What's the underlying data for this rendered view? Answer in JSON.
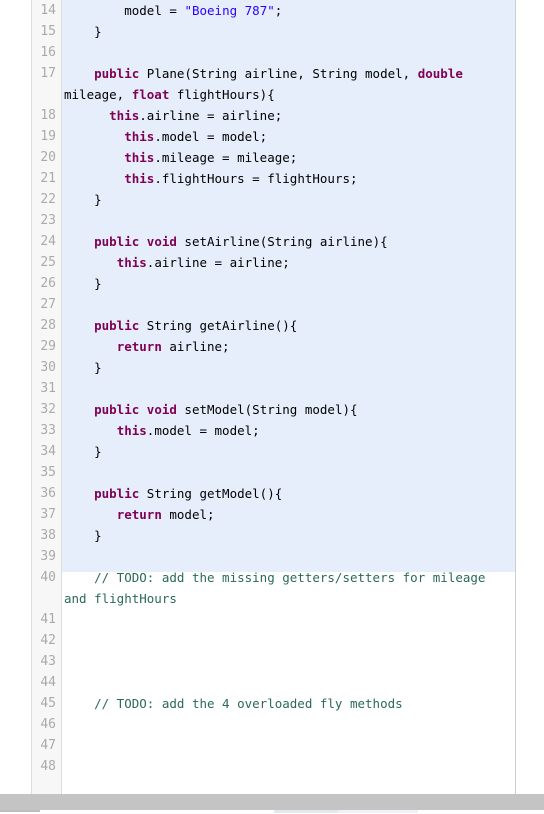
{
  "editor": {
    "language": "Java",
    "first_visible_line": 14,
    "last_visible_line": 48,
    "colors": {
      "background": "#ffffff",
      "selection_background": "#e6eefb",
      "gutter_background": "#f7f7f7",
      "gutter_border": "#dedede",
      "line_number": "#aaaaaa",
      "keyword": "#7f0055",
      "string": "#2a00ff",
      "comment": "#2a6b52",
      "plain_text": "#000000",
      "margin_guide": "#c9cdd4",
      "status_bar": "#c4c4c4"
    },
    "lines": [
      {
        "number": "14",
        "tokens": [
          {
            "t": "pln",
            "s": "        model = "
          },
          {
            "t": "str",
            "s": "\"Boeing 787\""
          },
          {
            "t": "pln",
            "s": ";"
          }
        ]
      },
      {
        "number": "15",
        "tokens": [
          {
            "t": "pln",
            "s": "    }"
          }
        ]
      },
      {
        "number": "16",
        "tokens": [
          {
            "t": "pln",
            "s": ""
          }
        ]
      },
      {
        "number": "17",
        "tokens": [
          {
            "t": "pln",
            "s": "    "
          },
          {
            "t": "kw",
            "s": "public"
          },
          {
            "t": "pln",
            "s": " Plane(String airline, String model, "
          },
          {
            "t": "kw",
            "s": "double"
          },
          {
            "t": "pln",
            "s": " mileage, "
          },
          {
            "t": "kw",
            "s": "float"
          },
          {
            "t": "pln",
            "s": " flightHours){"
          }
        ]
      },
      {
        "number": "18",
        "tokens": [
          {
            "t": "pln",
            "s": "      "
          },
          {
            "t": "kw",
            "s": "this"
          },
          {
            "t": "pln",
            "s": ".airline = airline;"
          }
        ]
      },
      {
        "number": "19",
        "tokens": [
          {
            "t": "pln",
            "s": "        "
          },
          {
            "t": "kw",
            "s": "this"
          },
          {
            "t": "pln",
            "s": ".model = model;"
          }
        ]
      },
      {
        "number": "20",
        "tokens": [
          {
            "t": "pln",
            "s": "        "
          },
          {
            "t": "kw",
            "s": "this"
          },
          {
            "t": "pln",
            "s": ".mileage = mileage;"
          }
        ]
      },
      {
        "number": "21",
        "tokens": [
          {
            "t": "pln",
            "s": "        "
          },
          {
            "t": "kw",
            "s": "this"
          },
          {
            "t": "pln",
            "s": ".flightHours = flightHours;"
          }
        ]
      },
      {
        "number": "22",
        "tokens": [
          {
            "t": "pln",
            "s": "    }"
          }
        ]
      },
      {
        "number": "23",
        "tokens": [
          {
            "t": "pln",
            "s": ""
          }
        ]
      },
      {
        "number": "24",
        "tokens": [
          {
            "t": "pln",
            "s": "    "
          },
          {
            "t": "kw",
            "s": "public void"
          },
          {
            "t": "pln",
            "s": " setAirline(String airline){"
          }
        ]
      },
      {
        "number": "25",
        "tokens": [
          {
            "t": "pln",
            "s": "       "
          },
          {
            "t": "kw",
            "s": "this"
          },
          {
            "t": "pln",
            "s": ".airline = airline;"
          }
        ]
      },
      {
        "number": "26",
        "tokens": [
          {
            "t": "pln",
            "s": "    }"
          }
        ]
      },
      {
        "number": "27",
        "tokens": [
          {
            "t": "pln",
            "s": ""
          }
        ]
      },
      {
        "number": "28",
        "tokens": [
          {
            "t": "pln",
            "s": "    "
          },
          {
            "t": "kw",
            "s": "public"
          },
          {
            "t": "pln",
            "s": " String getAirline(){"
          }
        ]
      },
      {
        "number": "29",
        "tokens": [
          {
            "t": "pln",
            "s": "       "
          },
          {
            "t": "kw",
            "s": "return"
          },
          {
            "t": "pln",
            "s": " airline;"
          }
        ]
      },
      {
        "number": "30",
        "tokens": [
          {
            "t": "pln",
            "s": "    }"
          }
        ]
      },
      {
        "number": "31",
        "tokens": [
          {
            "t": "pln",
            "s": ""
          }
        ]
      },
      {
        "number": "32",
        "tokens": [
          {
            "t": "pln",
            "s": "    "
          },
          {
            "t": "kw",
            "s": "public void"
          },
          {
            "t": "pln",
            "s": " setModel(String model){"
          }
        ]
      },
      {
        "number": "33",
        "tokens": [
          {
            "t": "pln",
            "s": "       "
          },
          {
            "t": "kw",
            "s": "this"
          },
          {
            "t": "pln",
            "s": ".model = model;"
          }
        ]
      },
      {
        "number": "34",
        "tokens": [
          {
            "t": "pln",
            "s": "    }"
          }
        ]
      },
      {
        "number": "35",
        "tokens": [
          {
            "t": "pln",
            "s": ""
          }
        ]
      },
      {
        "number": "36",
        "tokens": [
          {
            "t": "pln",
            "s": "    "
          },
          {
            "t": "kw",
            "s": "public"
          },
          {
            "t": "pln",
            "s": " String getModel(){"
          }
        ]
      },
      {
        "number": "37",
        "tokens": [
          {
            "t": "pln",
            "s": "       "
          },
          {
            "t": "kw",
            "s": "return"
          },
          {
            "t": "pln",
            "s": " model;"
          }
        ]
      },
      {
        "number": "38",
        "tokens": [
          {
            "t": "pln",
            "s": "    }"
          }
        ]
      },
      {
        "number": "39",
        "tokens": [
          {
            "t": "pln",
            "s": ""
          }
        ]
      },
      {
        "number": "40",
        "tokens": [
          {
            "t": "cmt",
            "s": "    // TODO: add the missing getters/setters for mileage and flightHours"
          }
        ]
      },
      {
        "number": "41",
        "tokens": [
          {
            "t": "pln",
            "s": ""
          }
        ]
      },
      {
        "number": "42",
        "tokens": [
          {
            "t": "pln",
            "s": ""
          }
        ]
      },
      {
        "number": "43",
        "tokens": [
          {
            "t": "pln",
            "s": ""
          }
        ]
      },
      {
        "number": "44",
        "tokens": [
          {
            "t": "pln",
            "s": ""
          }
        ]
      },
      {
        "number": "45",
        "tokens": [
          {
            "t": "cmt",
            "s": "    // TODO: add the 4 overloaded fly methods"
          }
        ]
      },
      {
        "number": "46",
        "tokens": [
          {
            "t": "pln",
            "s": ""
          }
        ]
      },
      {
        "number": "47",
        "tokens": [
          {
            "t": "pln",
            "s": ""
          }
        ]
      },
      {
        "number": "48",
        "tokens": [
          {
            "t": "pln",
            "s": ""
          }
        ]
      }
    ]
  }
}
